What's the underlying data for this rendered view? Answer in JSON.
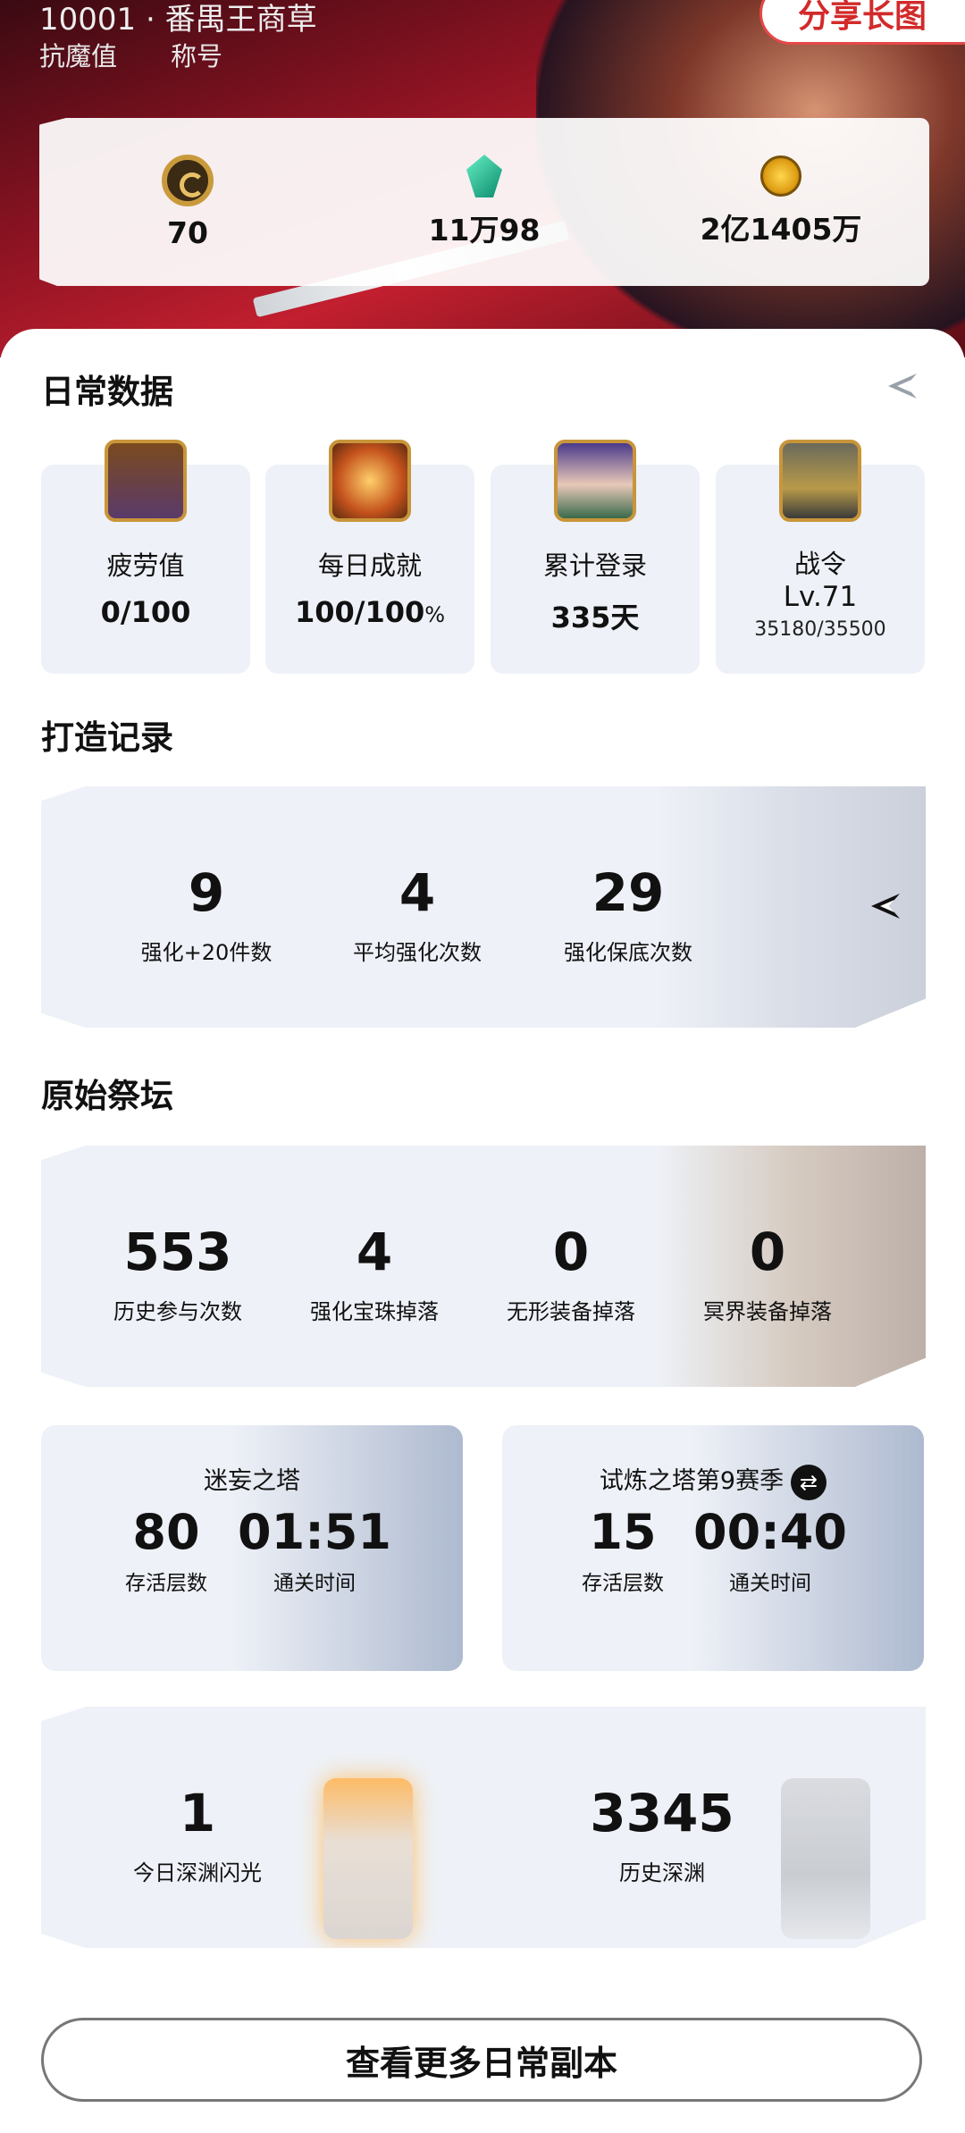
{
  "header": {
    "title_partial": "10001 · 番禺王商草",
    "tabs": [
      "抗魔值",
      "称号"
    ],
    "share_label": "分享长图",
    "resources": [
      {
        "icon": "c-coin-icon",
        "value": "70"
      },
      {
        "icon": "gem-icon",
        "value": "11万98"
      },
      {
        "icon": "gold-coin-icon",
        "value": "2亿1405万"
      }
    ]
  },
  "daily": {
    "title": "日常数据",
    "items": [
      {
        "icon": "fatigue-potion-icon",
        "label": "疲劳值",
        "value": "0/100"
      },
      {
        "icon": "daily-achievement-icon",
        "label": "每日成就",
        "value": "100/100",
        "unit": "%"
      },
      {
        "icon": "login-avatar-icon",
        "label": "累计登录",
        "value": "335天"
      },
      {
        "icon": "battle-pass-icon",
        "label": "战令",
        "value": "Lv.71",
        "sub": "35180/35500"
      }
    ]
  },
  "forge": {
    "title": "打造记录",
    "stats": [
      {
        "num": "9",
        "label": "强化+20件数"
      },
      {
        "num": "4",
        "label": "平均强化次数"
      },
      {
        "num": "29",
        "label": "强化保底次数"
      }
    ]
  },
  "altar": {
    "title": "原始祭坛",
    "stats": [
      {
        "num": "553",
        "label": "历史参与次数"
      },
      {
        "num": "4",
        "label": "强化宝珠掉落"
      },
      {
        "num": "0",
        "label": "无形装备掉落"
      },
      {
        "num": "0",
        "label": "冥界装备掉落"
      }
    ]
  },
  "towers": [
    {
      "title": "迷妄之塔",
      "floors": "80",
      "floors_label": "存活层数",
      "time": "01:51",
      "time_label": "通关时间"
    },
    {
      "title": "试炼之塔第9赛季",
      "floors": "15",
      "floors_label": "存活层数",
      "time": "00:40",
      "time_label": "通关时间"
    }
  ],
  "abyss": {
    "today": "1",
    "today_label": "今日深渊闪光",
    "history": "3345",
    "history_label": "历史深渊"
  },
  "more_button": "查看更多日常副本"
}
